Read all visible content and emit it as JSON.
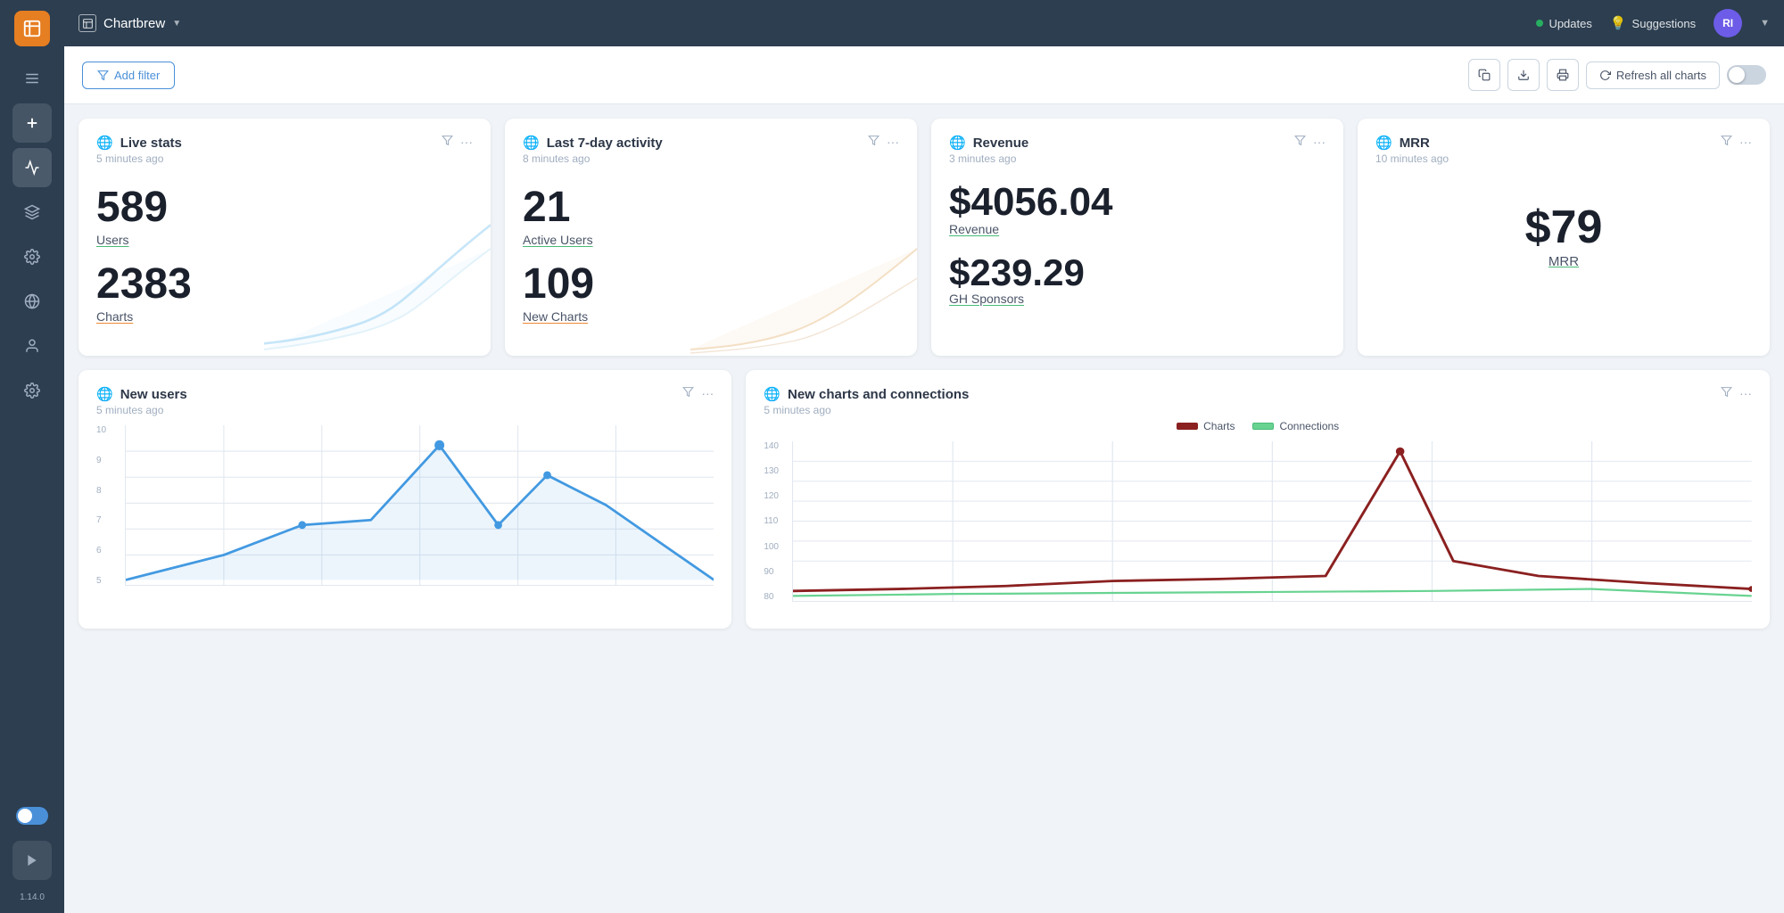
{
  "app": {
    "name": "Chartbrew",
    "version": "1.14.0"
  },
  "topbar": {
    "brand": "Chartbrew",
    "updates_label": "Updates",
    "suggestions_label": "Suggestions",
    "avatar_initials": "RI"
  },
  "toolbar": {
    "add_filter_label": "Add filter",
    "refresh_label": "Refresh all charts"
  },
  "cards": {
    "live_stats": {
      "title": "Live stats",
      "timestamp": "5 minutes ago",
      "stat1_value": "589",
      "stat1_label": "Users",
      "stat2_value": "2383",
      "stat2_label": "Charts"
    },
    "last_7day": {
      "title": "Last 7-day activity",
      "timestamp": "8 minutes ago",
      "stat1_value": "21",
      "stat1_label": "Active Users",
      "stat2_value": "109",
      "stat2_label": "New Charts"
    },
    "revenue": {
      "title": "Revenue",
      "timestamp": "3 minutes ago",
      "stat1_value": "$4056.04",
      "stat1_label": "Revenue",
      "stat2_value": "$239.29",
      "stat2_label": "GH Sponsors"
    },
    "mrr": {
      "title": "MRR",
      "timestamp": "10 minutes ago",
      "value": "$79",
      "label": "MRR"
    },
    "new_users": {
      "title": "New users",
      "timestamp": "5 minutes ago"
    },
    "new_charts": {
      "title": "New charts and connections",
      "timestamp": "5 minutes ago",
      "legend_charts": "Charts",
      "legend_connections": "Connections"
    }
  },
  "chart_new_users": {
    "y_labels": [
      "10",
      "9",
      "8",
      "7",
      "6",
      "5"
    ],
    "color": "#4299e1"
  },
  "chart_new_charts": {
    "y_labels": [
      "140",
      "130",
      "120",
      "110",
      "100",
      "90",
      "80"
    ],
    "color_charts": "#8B0000",
    "color_connections": "#68d391"
  }
}
